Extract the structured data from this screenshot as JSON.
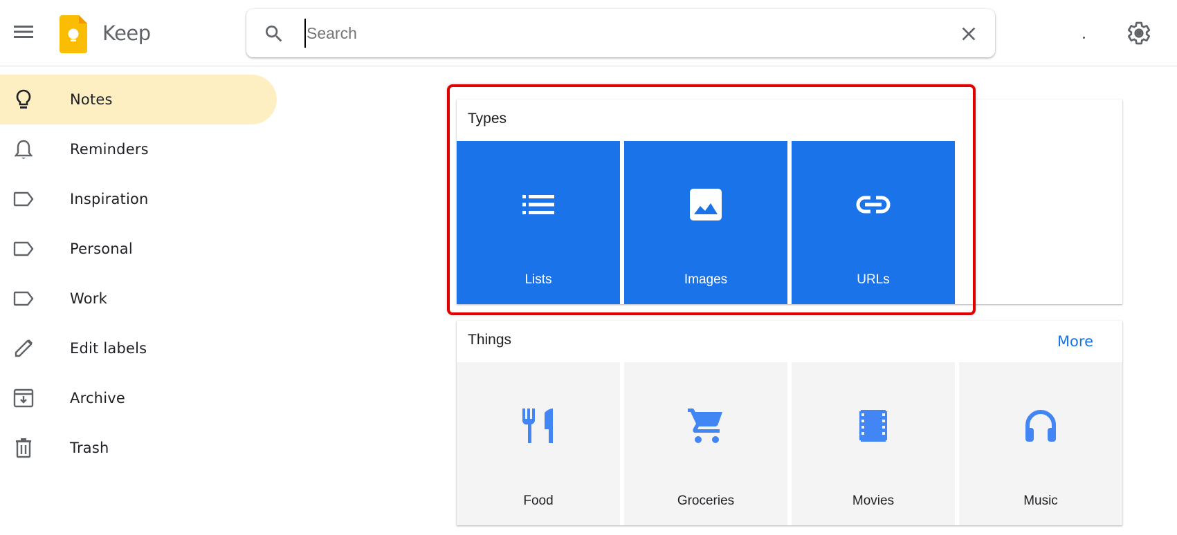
{
  "header": {
    "app_title": "Keep",
    "search": {
      "placeholder": "Search",
      "value": ""
    },
    "icons": [
      "menu-icon",
      "keep-logo",
      "search-icon",
      "close-icon",
      "settings-icon"
    ]
  },
  "sidebar": {
    "items": [
      {
        "label": "Notes",
        "icon": "lightbulb-icon",
        "active": true
      },
      {
        "label": "Reminders",
        "icon": "bell-icon",
        "active": false
      },
      {
        "label": "Inspiration",
        "icon": "label-icon",
        "active": false
      },
      {
        "label": "Personal",
        "icon": "label-icon",
        "active": false
      },
      {
        "label": "Work",
        "icon": "label-icon",
        "active": false
      },
      {
        "label": "Edit labels",
        "icon": "pencil-icon",
        "active": false
      },
      {
        "label": "Archive",
        "icon": "archive-icon",
        "active": false
      },
      {
        "label": "Trash",
        "icon": "trash-icon",
        "active": false
      }
    ]
  },
  "types": {
    "title": "Types",
    "tiles": [
      {
        "label": "Lists",
        "icon": "list-icon"
      },
      {
        "label": "Images",
        "icon": "image-icon"
      },
      {
        "label": "URLs",
        "icon": "link-icon"
      }
    ]
  },
  "things": {
    "title": "Things",
    "more_label": "More",
    "tiles": [
      {
        "label": "Food",
        "icon": "restaurant-icon"
      },
      {
        "label": "Groceries",
        "icon": "cart-icon"
      },
      {
        "label": "Movies",
        "icon": "film-icon"
      },
      {
        "label": "Music",
        "icon": "headphones-icon"
      }
    ]
  },
  "colors": {
    "accent_blue": "#1a73e8",
    "active_nav_bg": "#feefc3",
    "keep_yellow": "#fbbc04",
    "annotation_red": "#e00000",
    "icon_blue": "#4285f4"
  }
}
